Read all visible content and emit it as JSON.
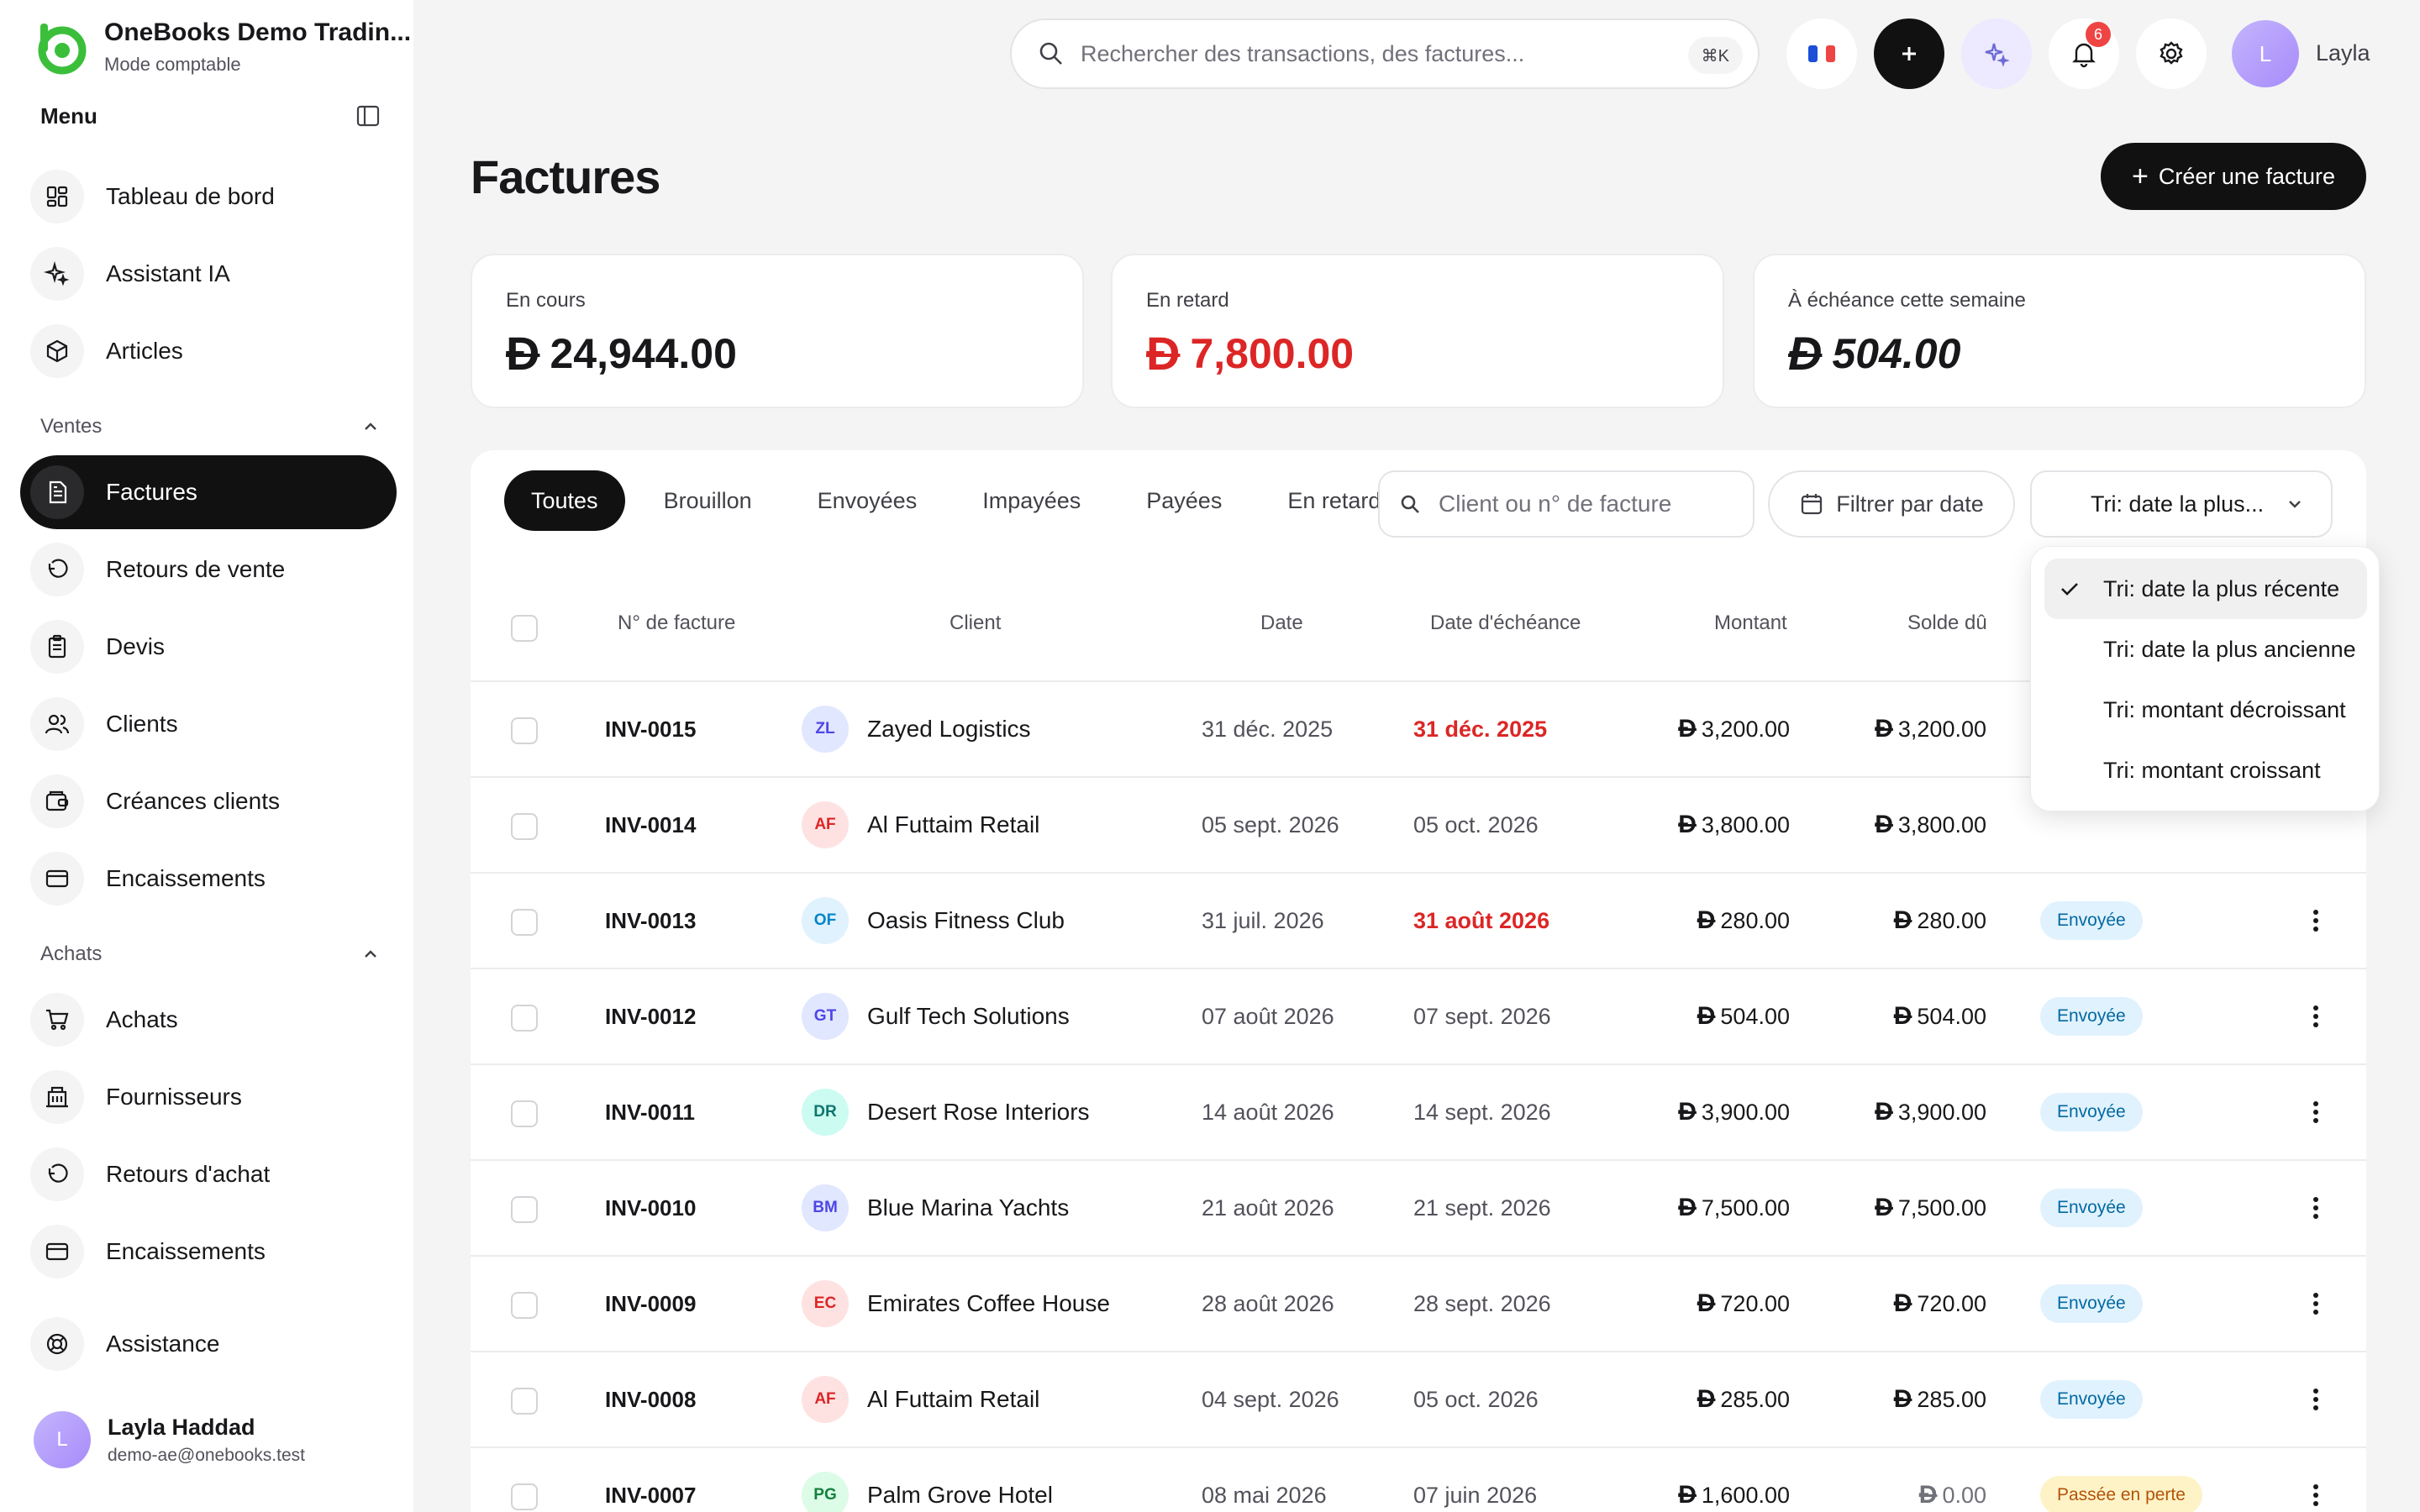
{
  "app": {
    "name": "OneBooks Demo Tradin...",
    "mode": "Mode comptable"
  },
  "sidebar": {
    "menu_label": "Menu",
    "top_items": [
      {
        "label": "Tableau de bord",
        "icon": "dashboard-icon"
      },
      {
        "label": "Assistant IA",
        "icon": "sparkles-icon"
      },
      {
        "label": "Articles",
        "icon": "box-icon"
      }
    ],
    "sales_section": "Ventes",
    "sales_items": [
      {
        "label": "Factures",
        "icon": "invoice-icon",
        "active": true
      },
      {
        "label": "Retours de vente",
        "icon": "return-icon"
      },
      {
        "label": "Devis",
        "icon": "clipboard-icon"
      },
      {
        "label": "Clients",
        "icon": "users-icon"
      },
      {
        "label": "Créances clients",
        "icon": "wallet-icon"
      },
      {
        "label": "Encaissements",
        "icon": "card-icon"
      }
    ],
    "purchases_section": "Achats",
    "purchase_items": [
      {
        "label": "Achats",
        "icon": "cart-icon"
      },
      {
        "label": "Fournisseurs",
        "icon": "building-icon"
      },
      {
        "label": "Retours d'achat",
        "icon": "return-icon"
      },
      {
        "label": "Encaissements",
        "icon": "card-icon"
      }
    ],
    "support_label": "Assistance",
    "user": {
      "initial": "L",
      "name": "Layla Haddad",
      "email": "demo-ae@onebooks.test"
    }
  },
  "topbar": {
    "search_placeholder": "Rechercher des transactions, des factures...",
    "shortcut": "⌘K",
    "notification_count": "6",
    "avatar_initial": "L",
    "username": "Layla"
  },
  "page": {
    "title": "Factures",
    "create_button": "Créer une facture"
  },
  "stats": [
    {
      "label": "En cours",
      "currency": "Đ",
      "value": "24,944.00"
    },
    {
      "label": "En retard",
      "currency": "Đ",
      "value": "7,800.00"
    },
    {
      "label": "À échéance cette semaine",
      "currency": "Đ",
      "value": "504.00"
    }
  ],
  "filters": {
    "tabs": [
      "Toutes",
      "Brouillon",
      "Envoyées",
      "Impayées",
      "Payées",
      "En retard"
    ],
    "active_tab": "Toutes",
    "search_placeholder": "Client ou n° de facture",
    "date_filter": "Filtrer par date",
    "sort_label": "Tri: date la plus..."
  },
  "table": {
    "headers": {
      "number": "N° de facture",
      "client": "Client",
      "date": "Date",
      "due": "Date d'échéance",
      "amount": "Montant",
      "balance": "Solde dû"
    },
    "currency": "Đ",
    "rows": [
      {
        "number": "INV-0015",
        "initials": "ZL",
        "client": "Zayed Logistics",
        "date": "31 déc. 2025",
        "due": "31 déc. 2025",
        "overdue": true,
        "amount": "3,200.00",
        "balance": "3,200.00",
        "status": ""
      },
      {
        "number": "INV-0014",
        "initials": "AF",
        "client": "Al Futtaim Retail",
        "date": "05 sept. 2026",
        "due": "05 oct. 2026",
        "overdue": false,
        "amount": "3,800.00",
        "balance": "3,800.00",
        "status": ""
      },
      {
        "number": "INV-0013",
        "initials": "OF",
        "client": "Oasis Fitness Club",
        "date": "31 juil. 2026",
        "due": "31 août 2026",
        "overdue": true,
        "amount": "280.00",
        "balance": "280.00",
        "status": "Envoyée"
      },
      {
        "number": "INV-0012",
        "initials": "GT",
        "client": "Gulf Tech Solutions",
        "date": "07 août 2026",
        "due": "07 sept. 2026",
        "overdue": false,
        "amount": "504.00",
        "balance": "504.00",
        "status": "Envoyée"
      },
      {
        "number": "INV-0011",
        "initials": "DR",
        "client": "Desert Rose Interiors",
        "date": "14 août 2026",
        "due": "14 sept. 2026",
        "overdue": false,
        "amount": "3,900.00",
        "balance": "3,900.00",
        "status": "Envoyée"
      },
      {
        "number": "INV-0010",
        "initials": "BM",
        "client": "Blue Marina Yachts",
        "date": "21 août 2026",
        "due": "21 sept. 2026",
        "overdue": false,
        "amount": "7,500.00",
        "balance": "7,500.00",
        "status": "Envoyée"
      },
      {
        "number": "INV-0009",
        "initials": "EC",
        "client": "Emirates Coffee House",
        "date": "28 août 2026",
        "due": "28 sept. 2026",
        "overdue": false,
        "amount": "720.00",
        "balance": "720.00",
        "status": "Envoyée"
      },
      {
        "number": "INV-0008",
        "initials": "AF",
        "client": "Al Futtaim Retail",
        "date": "04 sept. 2026",
        "due": "05 oct. 2026",
        "overdue": false,
        "amount": "285.00",
        "balance": "285.00",
        "status": "Envoyée"
      },
      {
        "number": "INV-0007",
        "initials": "PG",
        "client": "Palm Grove Hotel",
        "date": "08 mai 2026",
        "due": "07 juin 2026",
        "overdue": false,
        "amount": "1,600.00",
        "balance": "0.00",
        "status": "Passée en perte"
      }
    ]
  },
  "sort_menu": {
    "options": [
      "Tri: date la plus récente",
      "Tri: date la plus ancienne",
      "Tri: montant décroissant",
      "Tri: montant croissant"
    ],
    "selected": "Tri: date la plus récente"
  },
  "colors": {
    "accent_green": "#3bbf3b",
    "overdue_red": "#dc2626",
    "primary_dark": "#111112"
  }
}
